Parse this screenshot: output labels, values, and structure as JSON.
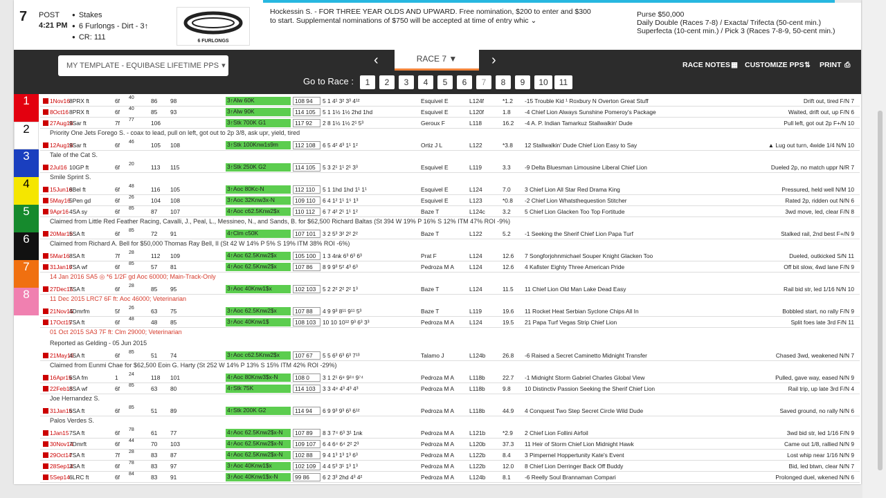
{
  "header": {
    "race_number": "7",
    "post_label": "POST",
    "post_time": "4:21 PM",
    "facts": [
      "Stakes",
      "6 Furlongs - Dirt - 3↑",
      "CR: 111"
    ],
    "logo_label": "6 FURLONGS",
    "conditions": "Hockessin S. - FOR THREE YEAR OLDS AND UPWARD. Free nomination, $200 to enter and $300 to start. Supplemental nominations of $750 will be accepted at time of entry whic",
    "purse": "Purse $50,000",
    "wagers": [
      "Daily Double (Races 7-8) / Exacta/ Trifecta (50-cent min.)",
      "Superfecta (10-cent min.) / Pick 3 (Races 7-8-9, 50-cent min.)"
    ]
  },
  "toolbar": {
    "template": "MY TEMPLATE - EQUIBASE LIFETIME PPS",
    "race": "RACE 7",
    "goto": "Go to Race :",
    "races": [
      "1",
      "2",
      "3",
      "4",
      "5",
      "6",
      "7",
      "8",
      "9",
      "10",
      "11"
    ],
    "race_notes": "RACE NOTES",
    "customize": "CUSTOMIZE PPS",
    "print": "PRINT"
  },
  "colors": {
    "c1": "#e3000f",
    "c2": "#ffffff",
    "c3": "#1a3fbf",
    "c4": "#f5e600",
    "c5": "#168a2d",
    "c6": "#111111",
    "c7": "#f07010",
    "c8": "#f080b0",
    "green": "#5ccd4f"
  },
  "rows": [
    {
      "date": "1Nov16",
      "track": "8PRX ft",
      "dist": "6f",
      "rating": "40",
      "b1": "86",
      "b2": "98",
      "race": "3↑Alw 60K",
      "score": "108 94",
      "pos": "5  1   4¹  3²  3³  4¹²",
      "jockey": "Esquivel E",
      "wt": "L124f",
      "odds": "*1.2",
      "trip": "-15 Trouble Kid ¹ Roxbury N Overton Great Stuff",
      "comment": "Drift out, tired   F/N  7"
    },
    {
      "date": "8Oct16",
      "track": "8PRX ft",
      "dist": "6f",
      "rating": "40",
      "b1": "85",
      "b2": "93",
      "race": "3↑Alw 90K",
      "score": "114 105",
      "pos": "5  1   1½  1½  2hd  1hd",
      "jockey": "Esquivel E",
      "wt": "L120f",
      "odds": "1.8",
      "trip": "-4 Chief Lion Always Sunshine Pomeroy's Package",
      "comment": "Waited, drift out, up   F/N  6"
    },
    {
      "date": "27Aug16",
      "track": "9Sar ft",
      "dist": "7f",
      "rating": "77",
      "b1": "106",
      "b2": "",
      "race": "3↑Stk 700K G1",
      "score": "117 92",
      "pos": "2  8   1½  1½  2¹  5³",
      "jockey": "Geroux F",
      "wt": "L118",
      "odds": "16.2",
      "trip": "-4 A. P. Indian Tamarkuz Stallwalkin' Dude",
      "comment": "Pull left, got out 2p  F+/N  10"
    },
    {
      "note": "Priority One Jets Forego S. - coax to lead, pull on left, got out to 2p 3/8, ask upr, yield, tired"
    },
    {
      "date": "12Aug16",
      "track": "9Sar ft",
      "dist": "6f",
      "rating": "46",
      "b1": "105",
      "b2": "108",
      "race": "3↑Stk 100Knw1s9m",
      "score": "112 108",
      "pos": "6  5   4²  4³  1¹  1²",
      "jockey": "Ortiz J L",
      "wt": "L122",
      "odds": "*3.8",
      "trip": "12 Stallwalkin' Dude Chief Lion Easy to Say",
      "comment": "▲ Lug out turn, 4wide 1/4  N/N  10"
    },
    {
      "note": "Tale of the Cat S."
    },
    {
      "date": "2Jul16",
      "track": "10GP ft",
      "dist": "6f",
      "rating": "20",
      "b1": "113",
      "b2": "115",
      "race": "3↑Stk 250K G2",
      "score": "114 105",
      "pos": "5  3   2¹  1¹  2¹  3³",
      "jockey": "Esquivel E",
      "wt": "L119",
      "odds": "3.3",
      "trip": "-9 Delta Bluesman Limousine Liberal Chief Lion",
      "comment": "Dueled 2p, no match uppr  N/R  7"
    },
    {
      "note": "Smile Sprint S."
    },
    {
      "date": "15Jun16",
      "track": "8Bel ft",
      "dist": "6f",
      "rating": "48",
      "b1": "116",
      "b2": "105",
      "race": "3↑Aoc 80Kc-N",
      "score": "112 110",
      "pos": "5  1   1hd  1hd  1¹  1¹",
      "jockey": "Esquivel E",
      "wt": "L124",
      "odds": "7.0",
      "trip": "3 Chief Lion All Star Red Drama King",
      "comment": "Pressured, held well  N/M  10"
    },
    {
      "date": "5May16",
      "track": "5Pen gd",
      "dist": "6f",
      "rating": "26",
      "b1": "104",
      "b2": "108",
      "race": "3↑Aoc 32Knw3x-N",
      "score": "109 110",
      "pos": "6  4   1²  1¹  1⁵  1³",
      "jockey": "Esquivel E",
      "wt": "L123",
      "odds": "*0.8",
      "trip": "-2 Chief Lion Whatsthequestion Stitcher",
      "comment": "Rated 2p, ridden out  N/N  6"
    },
    {
      "date": "9Apr16",
      "track": "4SA sy",
      "dist": "6f",
      "rating": "85",
      "b1": "87",
      "b2": "107",
      "race": "4↑Aoc c62.5Knw2$x",
      "score": "110 112",
      "pos": "6  7   4²  2¹  1¹  1²",
      "jockey": "Baze T",
      "wt": "L124c",
      "odds": "3.2",
      "trip": "5 Chief Lion Glacken Too Top Fortitude",
      "comment": "3wd move, led, clear  F/N  8"
    },
    {
      "note": "Claimed from Little Red Feather Racing, Cavalli, J., Peal, L., Messineo, N., and Sands, B. for $62,500 Richard Baltas (St 394 W 19% P 16% S 12% ITM 47% ROI -9%)"
    },
    {
      "date": "20Mar16",
      "track": "5SA ft",
      "dist": "6f",
      "rating": "85",
      "b1": "72",
      "b2": "91",
      "race": "4↑Clm c50K",
      "score": "107 101",
      "pos": "3  2   5³  3²  2²  2²",
      "jockey": "Baze T",
      "wt": "L122",
      "odds": "5.2",
      "trip": "-1 Seeking the Sherif Chief Lion Papa Turf",
      "comment": "Stalked rail, 2nd best  F+/N  9"
    },
    {
      "note": "Claimed from Richard A. Bell for $50,000 Thomas Ray Bell, II (St 42 W 14% P 5% S 19% ITM 38% ROI -6%)"
    },
    {
      "date": "5Mar16",
      "track": "8SA ft",
      "dist": "7f",
      "rating": "28",
      "b1": "112",
      "b2": "109",
      "race": "4↑Aoc 62.5Knw2$x",
      "score": "105 100",
      "pos": "1  3   4nk  6³  6³  6³",
      "jockey": "Prat F",
      "wt": "L124",
      "odds": "12.6",
      "trip": "7 Songforjohnmichael Souper Knight Glacken Too",
      "comment": "Dueled, outkicked  S/N  11"
    },
    {
      "date": "31Jan16",
      "track": "7SA wf",
      "dist": "6f",
      "rating": "85",
      "b1": "57",
      "b2": "81",
      "race": "4↑Aoc 62.5Knw2$x",
      "score": "107 86",
      "pos": "8  9   9³  5²  4³  6³",
      "jockey": "Pedroza M A",
      "wt": "L124",
      "odds": "12.6",
      "trip": "4 Kafister Eighty Three American Pride",
      "comment": "Off bit slow, 4wd lane  F/N  9"
    },
    {
      "note": "14 Jan 2016 SA5  ◎ *6 1/2F gd Aoc 60000; Main-Track-Only",
      "red": true
    },
    {
      "date": "27Dec15",
      "track": "7SA ft",
      "dist": "6f",
      "rating": "28",
      "b1": "85",
      "b2": "95",
      "race": "3↑Aoc 40Knw1$x",
      "score": "102 103",
      "pos": "5  2   2²  2²  2²  1³",
      "jockey": "Baze T",
      "wt": "L124",
      "odds": "11.5",
      "trip": "11 Chief Lion Old Man Lake Dead Easy",
      "comment": "Rail bid str, led 1/16  N/N  10"
    },
    {
      "note": "11 Dec 2015 LRC7    6F    ft: Aoc    46000; Veterinarian",
      "red": true
    },
    {
      "date": "21Nov15",
      "track": "4Dmrfm",
      "dist": "5f",
      "rating": "26",
      "b1": "63",
      "b2": "75",
      "race": "3↑Aoc 62.5Knw2$x",
      "score": "107 88",
      "pos": "4  9   9³  8¹¹  9¹¹  5³",
      "jockey": "Baze T",
      "wt": "L119",
      "odds": "19.6",
      "trip": "11 Rocket Heat Serbian Syclone Chips All In",
      "comment": "Bobbled start, no rally  F/N  9"
    },
    {
      "date": "17Oct15",
      "track": "7SA ft",
      "dist": "6f",
      "rating": "48",
      "b1": "48",
      "b2": "85",
      "race": "3↑Aoc 40Knw1$",
      "score": "108 103",
      "pos": "10 10  10¹²  9³  6³  3³",
      "jockey": "Pedroza M A",
      "wt": "L124",
      "odds": "19.5",
      "trip": "21 Papa Turf Vegas Strip Chief Lion",
      "comment": "Split foes late 3rd  F/N  11"
    },
    {
      "note": "01 Oct 2015 SA3    7F    ft: Clm    29000; Veterinarian",
      "red": true
    },
    {
      "note": "Reported as Gelding - 05 Jun 2015"
    },
    {
      "date": "21May15",
      "track": "4SA ft",
      "dist": "6f",
      "rating": "85",
      "b1": "51",
      "b2": "74",
      "race": "3↑Aoc c62.5Knw2$x",
      "score": "107 67",
      "pos": "5  5   6³  6³  6³  7¹³",
      "jockey": "Talamo J",
      "wt": "L124b",
      "odds": "26.8",
      "trip": "-6 Raised a Secret Caminetto Midnight Transfer",
      "comment": "Chased 3wd, weakened  N/N  7"
    },
    {
      "note": "Claimed from Eunmi Chae for $62,500 Eoin G. Harty (St 252 W 14% P 13% S 15% ITM 42% ROI -29%)"
    },
    {
      "date": "16Apr15",
      "track": "6SA fm",
      "dist": "1",
      "rating": "24",
      "b1": "118",
      "b2": "101",
      "race": "4↑Aoc 80Knw3$x-N",
      "score": "108 0",
      "pos": "3  1   2¹  6⁸  9²⁴  9⁷⁴",
      "jockey": "Pedroza M A",
      "wt": "L118b",
      "odds": "22.7",
      "trip": "-1 Midnight Storm Gabriel Charles Global View",
      "comment": "Pulled, gave way, eased  N/N  9"
    },
    {
      "date": "22Feb15",
      "track": "8SA wf",
      "dist": "6f",
      "rating": "85",
      "b1": "63",
      "b2": "80",
      "race": "4↑Stk 75K",
      "score": "114 103",
      "pos": "3  3   4⁸  4³  4³  4³",
      "jockey": "Pedroza M A",
      "wt": "L118b",
      "odds": "9.8",
      "trip": "10 Distinctiv Passion Seeking the Sherif Chief Lion",
      "comment": "Rail trip, up late 3rd  F/N  4"
    },
    {
      "note": "Joe Hernandez S."
    },
    {
      "date": "31Jan15",
      "track": "6SA ft",
      "dist": "6f",
      "rating": "85",
      "b1": "51",
      "b2": "89",
      "race": "4↑Stk 200K G2",
      "score": "114 94",
      "pos": "6  9   9³  9³  6³  6¹²",
      "jockey": "Pedroza M A",
      "wt": "L118b",
      "odds": "44.9",
      "trip": "4 Conquest Two Step Secret Circle Wild Dude",
      "comment": "Saved ground, no rally  N/N  6"
    },
    {
      "note": "Palos Verdes S."
    },
    {
      "date": "1Jan15",
      "track": "7SA ft",
      "dist": "6f",
      "rating": "78",
      "b1": "61",
      "b2": "77",
      "race": "4↑Aoc 62.5Knw2$x-N",
      "score": "107 89",
      "pos": "8  3   7⁴  6³  3¹  1nk",
      "jockey": "Pedroza M A",
      "wt": "L121b",
      "odds": "*2.9",
      "trip": "2 Chief Lion Follini Airfoil",
      "comment": "3wd bid str, led 1/16  F/N  9"
    },
    {
      "date": "30Nov14",
      "track": "7Dmrft",
      "dist": "6f",
      "rating": "44",
      "b1": "70",
      "b2": "103",
      "race": "4↑Aoc 62.5Knw2$x-N",
      "score": "109 107",
      "pos": "6  4   6⁴  6⁴  2²  2³",
      "jockey": "Pedroza M A",
      "wt": "L120b",
      "odds": "37.3",
      "trip": "11 Heir of Storm Chief Lion Midnight Hawk",
      "comment": "Came out 1/8, rallied  N/N  9"
    },
    {
      "date": "29Oct14",
      "track": "7SA ft",
      "dist": "7f",
      "rating": "28",
      "b1": "83",
      "b2": "87",
      "race": "4↑Aoc 62.5Knw2$x-N",
      "score": "102 88",
      "pos": "9  4   1³  1³  1³  6³",
      "jockey": "Pedroza M A",
      "wt": "L122b",
      "odds": "8.4",
      "trip": "3 Pimpernel Hoppertunity Kate's Event",
      "comment": "Lost whip near 1/16  N/N  9"
    },
    {
      "date": "28Sep14",
      "track": "3SA ft",
      "dist": "6f",
      "rating": "78",
      "b1": "83",
      "b2": "97",
      "race": "3↑Aoc 40Knw1$x",
      "score": "102 109",
      "pos": "4  4   5³  3¹  1³  1³",
      "jockey": "Pedroza M A",
      "wt": "L122b",
      "odds": "12.0",
      "trip": "8 Chief Lion Derringer Back Off Buddy",
      "comment": "Bid, led btwn, clear  N/N  7"
    },
    {
      "date": "5Sep14",
      "track": "6LRC ft",
      "dist": "6f",
      "rating": "84",
      "b1": "83",
      "b2": "91",
      "race": "3↑Aoc 40Knw1$x-N",
      "score": "99 86",
      "pos": "6  2   3³  2hd  4³  4²",
      "jockey": "Pedroza M A",
      "wt": "L124b",
      "odds": "8.1",
      "trip": "-6 Reelly Soul Brannaman Compari",
      "comment": "Prolonged duel, wkened  N/N  6"
    }
  ]
}
